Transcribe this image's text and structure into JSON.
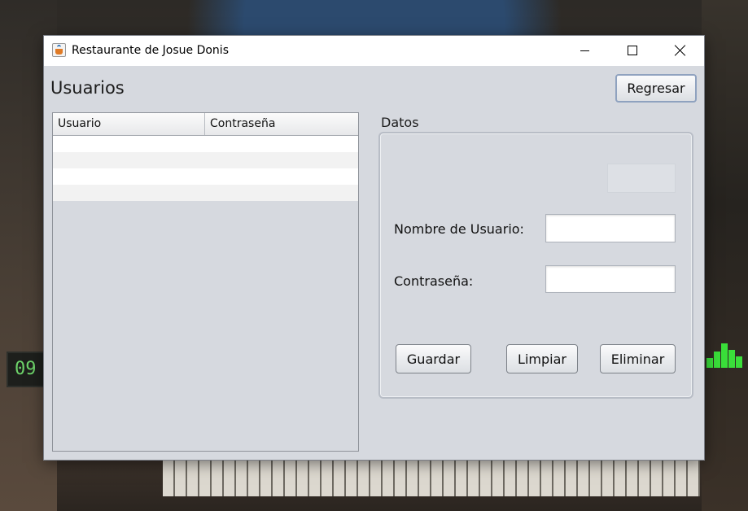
{
  "window": {
    "title": "Restaurante de Josue Donis"
  },
  "header": {
    "title": "Usuarios",
    "back_button": "Regresar"
  },
  "table": {
    "columns": [
      "Usuario",
      "Contraseña"
    ],
    "rows": [
      [
        "",
        ""
      ],
      [
        "",
        ""
      ],
      [
        "",
        ""
      ],
      [
        "",
        ""
      ]
    ]
  },
  "form": {
    "group_title": "Datos",
    "id_value": "",
    "user_label": "Nombre de Usuario:",
    "user_value": "",
    "password_label": "Contraseña:",
    "password_value": "",
    "buttons": {
      "save": "Guardar",
      "clear": "Limpiar",
      "delete": "Eliminar"
    }
  },
  "desktop": {
    "clock_digits": "09"
  },
  "icons": {
    "app": "java-coffee-cup-icon",
    "minimize": "minimize-icon",
    "maximize": "maximize-icon",
    "close": "close-icon"
  },
  "colors": {
    "window_bg": "#d6d9df",
    "focus_border": "#8fa2bf"
  }
}
